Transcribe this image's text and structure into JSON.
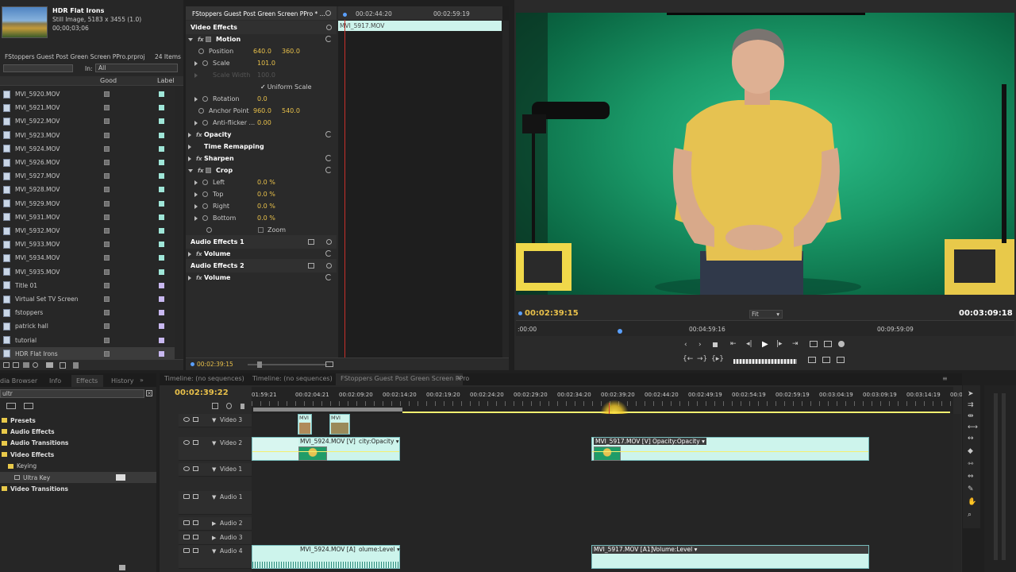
{
  "project": {
    "preview_name": "HDR Flat Irons",
    "preview_info": "Still Image, 5183 x 3455 (1.0)",
    "preview_duration": "00;00;03;06",
    "project_file": "FStoppers Guest Post Green Screen PPro.prproj",
    "item_count": "24 Items",
    "in_label": "In:",
    "in_value": "All",
    "col_good": "Good",
    "col_label": "Label",
    "items": [
      {
        "name": "MVI_5920.MOV",
        "color": "#9fe6d8"
      },
      {
        "name": "MVI_5921.MOV",
        "color": "#9fe6d8"
      },
      {
        "name": "MVI_5922.MOV",
        "color": "#9fe6d8"
      },
      {
        "name": "MVI_5923.MOV",
        "color": "#9fe6d8"
      },
      {
        "name": "MVI_5924.MOV",
        "color": "#9fe6d8"
      },
      {
        "name": "MVI_5926.MOV",
        "color": "#9fe6d8"
      },
      {
        "name": "MVI_5927.MOV",
        "color": "#9fe6d8"
      },
      {
        "name": "MVI_5928.MOV",
        "color": "#9fe6d8"
      },
      {
        "name": "MVI_5929.MOV",
        "color": "#9fe6d8"
      },
      {
        "name": "MVI_5931.MOV",
        "color": "#9fe6d8"
      },
      {
        "name": "MVI_5932.MOV",
        "color": "#9fe6d8"
      },
      {
        "name": "MVI_5933.MOV",
        "color": "#9fe6d8"
      },
      {
        "name": "MVI_5934.MOV",
        "color": "#9fe6d8"
      },
      {
        "name": "MVI_5935.MOV",
        "color": "#9fe6d8"
      },
      {
        "name": "Title 01",
        "color": "#c8b8f0"
      },
      {
        "name": "Virtual Set TV Screen",
        "color": "#c8b8f0"
      },
      {
        "name": "fstoppers",
        "color": "#c8b8f0"
      },
      {
        "name": "patrick hall",
        "color": "#c8b8f0"
      },
      {
        "name": "tutorial",
        "color": "#c8b8f0"
      },
      {
        "name": "HDR Flat Irons",
        "color": "#c8b8f0"
      }
    ]
  },
  "effect_controls": {
    "title": "FStoppers Guest Post Green Screen PPro * ...",
    "tc_start": "00:02:44:20",
    "tc_end": "00:02:59:19",
    "clip_name": "MVI_5917.MOV",
    "video_effects": "Video Effects",
    "motion": "Motion",
    "position_label": "Position",
    "position_x": "640.0",
    "position_y": "360.0",
    "scale_label": "Scale",
    "scale_value": "101.0",
    "scale_width_label": "Scale Width",
    "scale_width_value": "100.0",
    "uniform_scale": "Uniform Scale",
    "rotation_label": "Rotation",
    "rotation_value": "0.0",
    "anchor_label": "Anchor Point",
    "anchor_x": "960.0",
    "anchor_y": "540.0",
    "antiflicker_label": "Anti-flicker ...",
    "antiflicker_value": "0.00",
    "opacity": "Opacity",
    "time_remapping": "Time Remapping",
    "sharpen": "Sharpen",
    "crop": "Crop",
    "left_label": "Left",
    "left_value": "0.0 %",
    "top_label": "Top",
    "top_value": "0.0 %",
    "right_label": "Right",
    "right_value": "0.0 %",
    "bottom_label": "Bottom",
    "bottom_value": "0.0 %",
    "zoom": "Zoom",
    "audio1": "Audio Effects 1",
    "volume1": "Volume",
    "audio2": "Audio Effects 2",
    "volume2": "Volume",
    "bottom_tc": "00:02:39:15"
  },
  "program": {
    "current_tc": "00:02:39:15",
    "fit": "Fit",
    "duration": "00:03:09:18",
    "ruler": [
      ":00:00",
      "00:04:59:16",
      "00:09:59:09"
    ]
  },
  "left_tabs": {
    "media_browser": "dia Browser",
    "info": "Info",
    "effects": "Effects",
    "history": "History",
    "search_value": "ultr",
    "tree": [
      {
        "label": "Presets",
        "indent": 0
      },
      {
        "label": "Audio Effects",
        "indent": 0
      },
      {
        "label": "Audio Transitions",
        "indent": 0
      },
      {
        "label": "Video Effects",
        "indent": 0
      },
      {
        "label": "Keying",
        "indent": 1
      },
      {
        "label": "Ultra Key",
        "indent": 2
      },
      {
        "label": "Video Transitions",
        "indent": 0
      }
    ]
  },
  "timeline": {
    "tab1": "Timeline: (no sequences)",
    "tab2": "Timeline: (no sequences)",
    "tab3": "FStoppers Guest Post Green Screen PPro",
    "current_tc": "00:02:39:22",
    "ruler": [
      "01:59:21",
      "00:02:04:21",
      "00:02:09:20",
      "00:02:14:20",
      "00:02:19:20",
      "00:02:24:20",
      "00:02:29:20",
      "00:02:34:20",
      "00:02:39:20",
      "00:02:44:20",
      "00:02:49:19",
      "00:02:54:19",
      "00:02:59:19",
      "00:03:04:19",
      "00:03:09:19",
      "00:03:14:19",
      "00:0"
    ],
    "tracks": [
      "Video 3",
      "Video 2",
      "Video 1",
      "Audio 1",
      "Audio 2",
      "Audio 3",
      "Audio 4"
    ],
    "clip_v2_a": "MVI_5924.MOV [V]",
    "clip_v2_a_fx": "city:Opacity",
    "clip_v2_b": "MVI_5917.MOV [V]",
    "clip_v2_b_fx": "Opacity:Opacity",
    "clip_a4_a": "MVI_5924.MOV [A]",
    "clip_a4_a_fx": "olume:Level",
    "clip_a4_b": "MVI_5917.MOV [A1]",
    "clip_a4_b_fx": "Volume:Level",
    "v3_clip1": "MVI",
    "v3_clip2": "MVI"
  }
}
